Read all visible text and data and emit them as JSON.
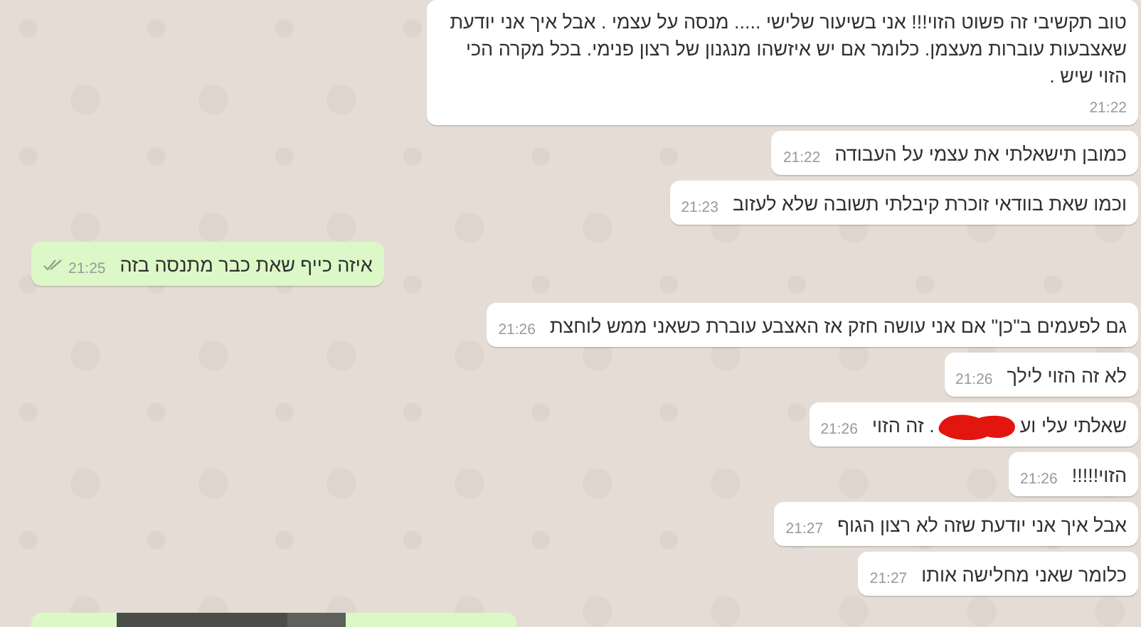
{
  "messages": [
    {
      "outgoing": false,
      "text": "טוב תקשיבי זה פשוט הזוי!!! אני בשיעור שלישי ..... מנסה על עצמי . אבל איך אני יודעת שאצבעות עוברות מעצמן. כלומר אם יש איזשהו מנגנון של רצון פנימי. בכל מקרה הכי הזוי שיש .",
      "time": "21:22"
    },
    {
      "outgoing": false,
      "text": "כמובן תישאלתי את עצמי על העבודה",
      "time": "21:22"
    },
    {
      "outgoing": false,
      "text": "וכמו שאת בוודאי זוכרת קיבלתי תשובה שלא לעזוב",
      "time": "21:23"
    },
    {
      "outgoing": true,
      "text": "איזה כייף שאת כבר מתנסה בזה",
      "time": "21:25",
      "read": false
    },
    {
      "outgoing": false,
      "text": "גם לפעמים ב\"כן\" אם אני עושה חזק אז האצבע עוברת כשאני ממש לוחצת",
      "time": "21:26"
    },
    {
      "outgoing": false,
      "text": "לא זה הזוי לילך",
      "time": "21:26"
    },
    {
      "outgoing": false,
      "text": "שאלתי עלי וע",
      "redacted": true,
      "text_after": ". זה הזוי",
      "time": "21:26"
    },
    {
      "outgoing": false,
      "text": "הזוי!!!!!",
      "time": "21:26"
    },
    {
      "outgoing": false,
      "text": "אבל איך אני יודעת שזה לא רצון הגוף",
      "time": "21:27"
    },
    {
      "outgoing": false,
      "text": "כלומר שאני מחלישה אותו",
      "time": "21:27"
    },
    {
      "outgoing": true,
      "kind": "picture"
    }
  ]
}
